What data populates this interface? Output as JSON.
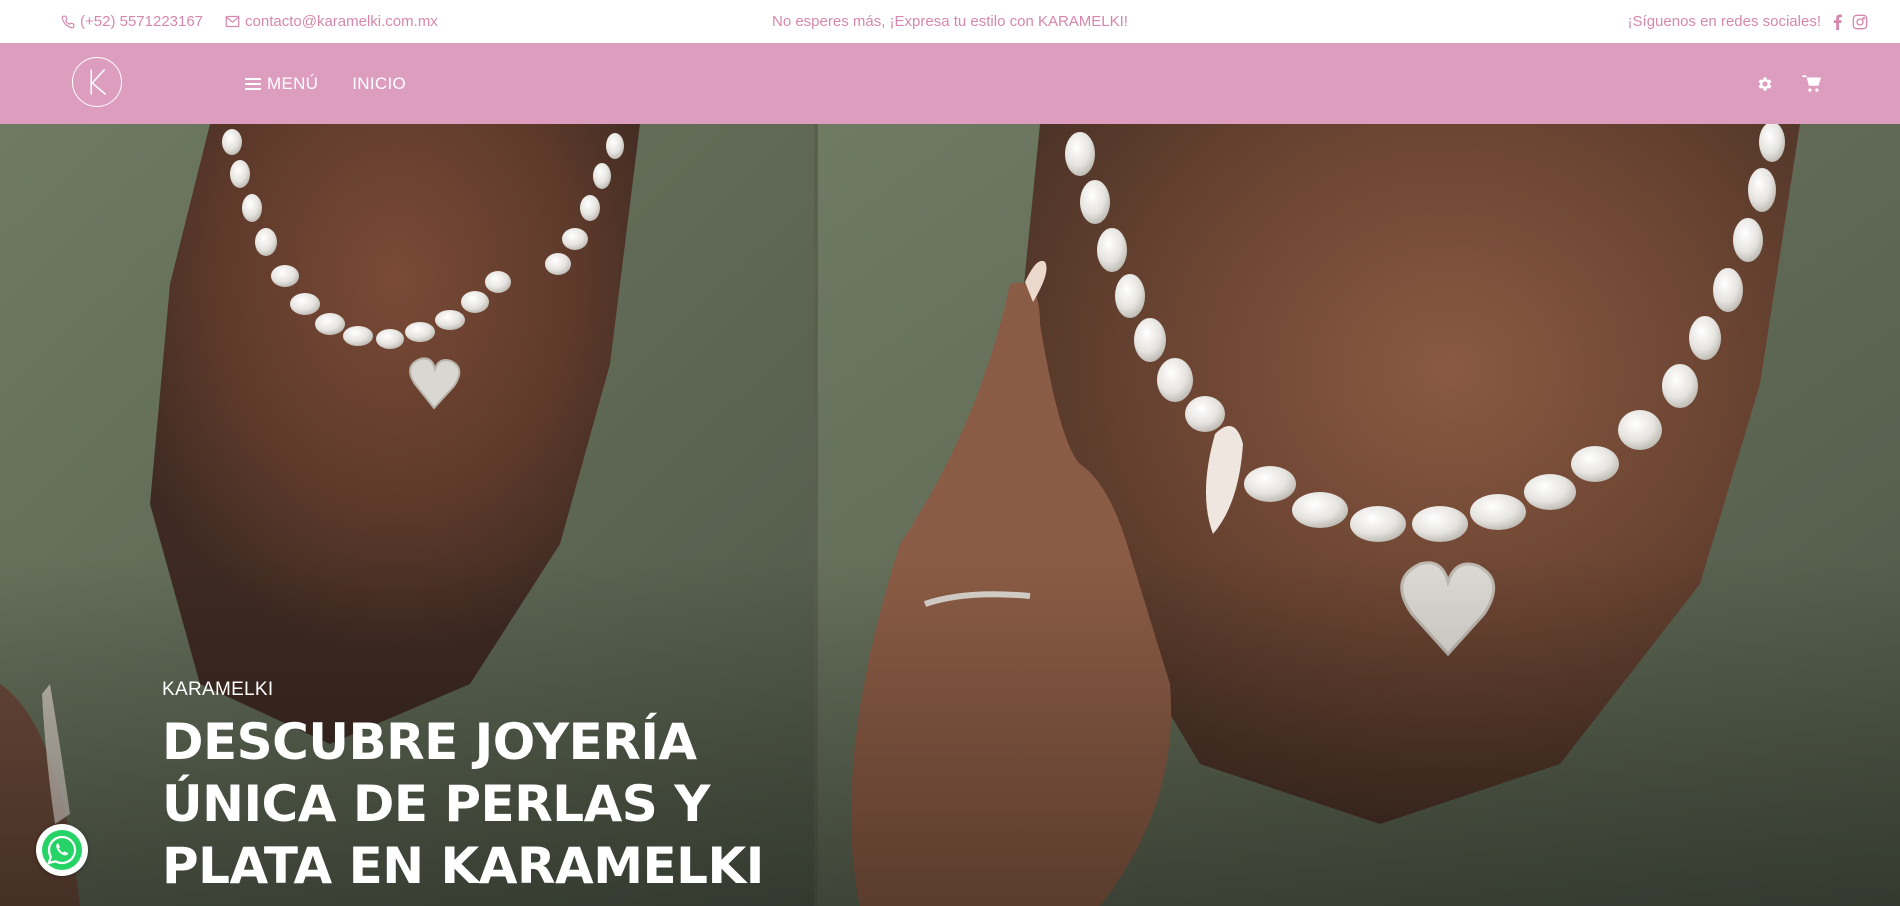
{
  "topbar": {
    "phone": "(+52) 5571223167",
    "email": "contacto@karamelki.com.mx",
    "promo": "No esperes más, ¡Expresa tu estilo con KARAMELKI!",
    "social_label": "¡Síguenos en redes sociales!",
    "social_icons": [
      "facebook-icon",
      "instagram-icon"
    ]
  },
  "navbar": {
    "logo_letter": "K",
    "menu_label": "MENÚ",
    "home_label": "INICIO",
    "right_icons": [
      "gear-icon",
      "cart-icon"
    ]
  },
  "hero": {
    "eyebrow": "KARAMELKI",
    "title_line1": "DESCUBRE JOYERÍA",
    "title_line2": "ÚNICA DE PERLAS Y",
    "title_line3": "PLATA EN KARAMELKI"
  },
  "colors": {
    "accent_pink": "#dd9dbf",
    "text_pink": "#d687ad",
    "whatsapp_green": "#25d366"
  },
  "floating": {
    "whatsapp_icon": "whatsapp-icon"
  }
}
